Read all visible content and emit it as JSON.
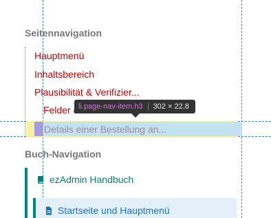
{
  "seitennavigation": {
    "title": "Seitennavigation",
    "items": [
      {
        "label": "Hauptmenü"
      },
      {
        "label": "Inhaltsbereich"
      },
      {
        "label": "Plausibilität & Verifizier..."
      },
      {
        "label": "Felder d"
      },
      {
        "label": "Details einer Bestellung an..."
      }
    ]
  },
  "devtools_tooltip": {
    "selector": "li.page-nav-item.h3",
    "dimensions": "302 × 22.8"
  },
  "buch_navigation": {
    "title": "Buch-Navigation",
    "book": {
      "label": "ezAdmin Handbuch",
      "icon": "book-icon"
    },
    "chapter": {
      "label": "Startseite und Hauptmenü",
      "icon": "document-icon"
    }
  },
  "colors": {
    "link_red": "#c40000",
    "accent_teal": "#008a80",
    "chapter_blue": "#1a73b8",
    "highlight_content": "#bfe0f3",
    "highlight_padding": "#f4f3a4"
  }
}
